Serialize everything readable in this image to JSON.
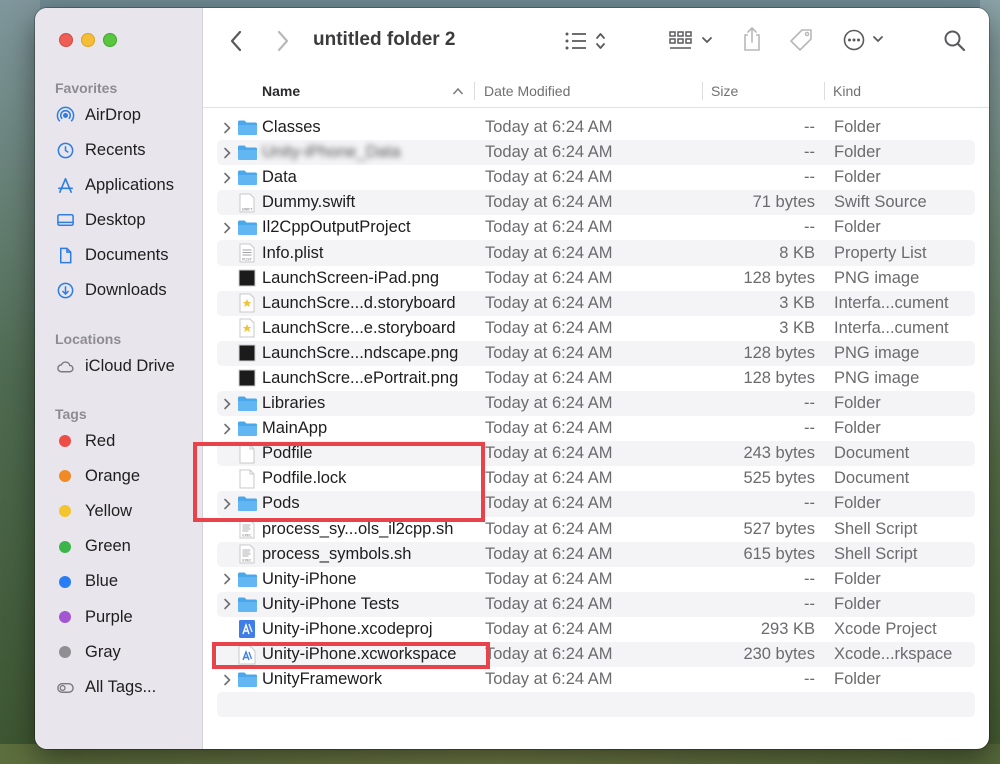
{
  "window": {
    "title": "untitled folder 2"
  },
  "sidebar": {
    "favorites_label": "Favorites",
    "favorites": [
      {
        "label": "AirDrop",
        "icon": "airdrop-icon"
      },
      {
        "label": "Recents",
        "icon": "clock-icon"
      },
      {
        "label": "Applications",
        "icon": "applications-icon"
      },
      {
        "label": "Desktop",
        "icon": "desktop-icon"
      },
      {
        "label": "Documents",
        "icon": "document-icon"
      },
      {
        "label": "Downloads",
        "icon": "download-icon"
      }
    ],
    "locations_label": "Locations",
    "locations": [
      {
        "label": "iCloud Drive",
        "icon": "cloud-icon"
      }
    ],
    "tags_label": "Tags",
    "tags": [
      {
        "label": "Red",
        "color": "#ee4c47"
      },
      {
        "label": "Orange",
        "color": "#f08a24"
      },
      {
        "label": "Yellow",
        "color": "#f3c42e"
      },
      {
        "label": "Green",
        "color": "#3bb54a"
      },
      {
        "label": "Blue",
        "color": "#2a7cf5"
      },
      {
        "label": "Purple",
        "color": "#a356d1"
      },
      {
        "label": "Gray",
        "color": "#8e8e93"
      },
      {
        "label": "All Tags...",
        "color": ""
      }
    ]
  },
  "columns": {
    "name": "Name",
    "date": "Date Modified",
    "size": "Size",
    "kind": "Kind"
  },
  "files": [
    {
      "name": "Classes",
      "type": "folder",
      "date": "Today at 6:24 AM",
      "size": "--",
      "kind": "Folder"
    },
    {
      "name": "Unity-iPhone_Data",
      "type": "folder",
      "date": "Today at 6:24 AM",
      "size": "--",
      "kind": "Folder",
      "blurred": true
    },
    {
      "name": "Data",
      "type": "folder",
      "date": "Today at 6:24 AM",
      "size": "--",
      "kind": "Folder"
    },
    {
      "name": "Dummy.swift",
      "type": "doc",
      "date": "Today at 6:24 AM",
      "size": "71 bytes",
      "kind": "Swift Source"
    },
    {
      "name": "Il2CppOutputProject",
      "type": "folder",
      "date": "Today at 6:24 AM",
      "size": "--",
      "kind": "Folder"
    },
    {
      "name": "Info.plist",
      "type": "plist",
      "date": "Today at 6:24 AM",
      "size": "8 KB",
      "kind": "Property List"
    },
    {
      "name": "LaunchScreen-iPad.png",
      "type": "png",
      "date": "Today at 6:24 AM",
      "size": "128 bytes",
      "kind": "PNG image"
    },
    {
      "name": "LaunchScre...d.storyboard",
      "type": "storyboard",
      "date": "Today at 6:24 AM",
      "size": "3 KB",
      "kind": "Interfa...cument"
    },
    {
      "name": "LaunchScre...e.storyboard",
      "type": "storyboard",
      "date": "Today at 6:24 AM",
      "size": "3 KB",
      "kind": "Interfa...cument"
    },
    {
      "name": "LaunchScre...ndscape.png",
      "type": "png",
      "date": "Today at 6:24 AM",
      "size": "128 bytes",
      "kind": "PNG image"
    },
    {
      "name": "LaunchScre...ePortrait.png",
      "type": "png",
      "date": "Today at 6:24 AM",
      "size": "128 bytes",
      "kind": "PNG image"
    },
    {
      "name": "Libraries",
      "type": "folder",
      "date": "Today at 6:24 AM",
      "size": "--",
      "kind": "Folder"
    },
    {
      "name": "MainApp",
      "type": "folder",
      "date": "Today at 6:24 AM",
      "size": "--",
      "kind": "Folder"
    },
    {
      "name": "Podfile",
      "type": "blank",
      "date": "Today at 6:24 AM",
      "size": "243 bytes",
      "kind": "Document"
    },
    {
      "name": "Podfile.lock",
      "type": "blank",
      "date": "Today at 6:24 AM",
      "size": "525 bytes",
      "kind": "Document"
    },
    {
      "name": "Pods",
      "type": "folder",
      "date": "Today at 6:24 AM",
      "size": "--",
      "kind": "Folder"
    },
    {
      "name": "process_sy...ols_il2cpp.sh",
      "type": "sh",
      "date": "Today at 6:24 AM",
      "size": "527 bytes",
      "kind": "Shell Script"
    },
    {
      "name": "process_symbols.sh",
      "type": "sh",
      "date": "Today at 6:24 AM",
      "size": "615 bytes",
      "kind": "Shell Script"
    },
    {
      "name": "Unity-iPhone",
      "type": "folder",
      "date": "Today at 6:24 AM",
      "size": "--",
      "kind": "Folder"
    },
    {
      "name": "Unity-iPhone Tests",
      "type": "folder",
      "date": "Today at 6:24 AM",
      "size": "--",
      "kind": "Folder"
    },
    {
      "name": "Unity-iPhone.xcodeproj",
      "type": "xcodeproj",
      "date": "Today at 6:24 AM",
      "size": "293 KB",
      "kind": "Xcode Project"
    },
    {
      "name": "Unity-iPhone.xcworkspace",
      "type": "xcworkspace",
      "date": "Today at 6:24 AM",
      "size": "230 bytes",
      "kind": "Xcode...rkspace"
    },
    {
      "name": "UnityFramework",
      "type": "folder",
      "date": "Today at 6:24 AM",
      "size": "--",
      "kind": "Folder"
    }
  ],
  "colors": {
    "folder_blue": "#4aa7ec",
    "highlight_red": "#e8434b"
  }
}
